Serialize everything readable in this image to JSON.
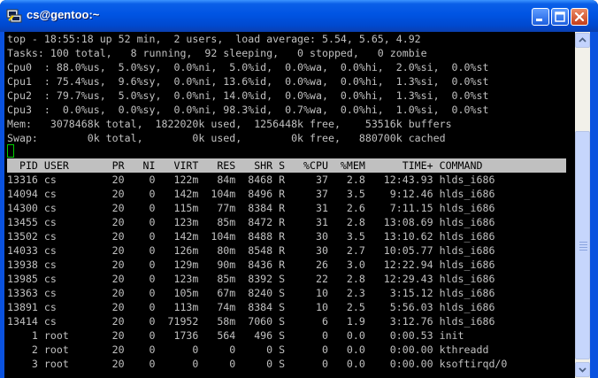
{
  "window": {
    "title": "cs@gentoo:~",
    "icon": "putty-terminal-icon"
  },
  "top": {
    "summary": [
      "top - 18:55:18 up 52 min,  2 users,  load average: 5.54, 5.65, 4.92",
      "Tasks: 100 total,   8 running,  92 sleeping,   0 stopped,   0 zombie",
      "Cpu0  : 88.0%us,  5.0%sy,  0.0%ni,  5.0%id,  0.0%wa,  0.0%hi,  2.0%si,  0.0%st",
      "Cpu1  : 75.4%us,  9.6%sy,  0.0%ni, 13.6%id,  0.0%wa,  0.0%hi,  1.3%si,  0.0%st",
      "Cpu2  : 79.7%us,  5.0%sy,  0.0%ni, 14.0%id,  0.0%wa,  0.0%hi,  1.3%si,  0.0%st",
      "Cpu3  :  0.0%us,  0.0%sy,  0.0%ni, 98.3%id,  0.7%wa,  0.0%hi,  1.0%si,  0.0%st",
      "Mem:   3078468k total,  1822020k used,  1256448k free,    53516k buffers",
      "Swap:        0k total,        0k used,        0k free,   880700k cached"
    ],
    "columns": [
      "PID",
      "USER",
      "PR",
      "NI",
      "VIRT",
      "RES",
      "SHR",
      "S",
      "%CPU",
      "%MEM",
      "TIME+",
      "COMMAND"
    ],
    "processes": [
      [
        "13316",
        "cs",
        "20",
        "0",
        "122m",
        "84m",
        "8468",
        "R",
        "37",
        "2.8",
        "12:43.93",
        "hlds_i686"
      ],
      [
        "14094",
        "cs",
        "20",
        "0",
        "142m",
        "104m",
        "8496",
        "R",
        "37",
        "3.5",
        "9:12.46",
        "hlds_i686"
      ],
      [
        "14300",
        "cs",
        "20",
        "0",
        "115m",
        "77m",
        "8384",
        "R",
        "31",
        "2.6",
        "7:11.15",
        "hlds_i686"
      ],
      [
        "13455",
        "cs",
        "20",
        "0",
        "123m",
        "85m",
        "8472",
        "R",
        "31",
        "2.8",
        "13:08.69",
        "hlds_i686"
      ],
      [
        "13502",
        "cs",
        "20",
        "0",
        "142m",
        "104m",
        "8488",
        "R",
        "30",
        "3.5",
        "13:10.62",
        "hlds_i686"
      ],
      [
        "14033",
        "cs",
        "20",
        "0",
        "126m",
        "80m",
        "8548",
        "R",
        "30",
        "2.7",
        "10:05.77",
        "hlds_i686"
      ],
      [
        "13938",
        "cs",
        "20",
        "0",
        "129m",
        "90m",
        "8436",
        "R",
        "26",
        "3.0",
        "12:22.94",
        "hlds_i686"
      ],
      [
        "13985",
        "cs",
        "20",
        "0",
        "123m",
        "85m",
        "8392",
        "S",
        "22",
        "2.8",
        "12:29.43",
        "hlds_i686"
      ],
      [
        "13363",
        "cs",
        "20",
        "0",
        "105m",
        "67m",
        "8240",
        "S",
        "10",
        "2.3",
        "3:15.12",
        "hlds_i686"
      ],
      [
        "13891",
        "cs",
        "20",
        "0",
        "113m",
        "74m",
        "8384",
        "S",
        "10",
        "2.5",
        "5:56.03",
        "hlds_i686"
      ],
      [
        "13414",
        "cs",
        "20",
        "0",
        "71952",
        "58m",
        "7060",
        "S",
        "6",
        "1.9",
        "3:12.76",
        "hlds_i686"
      ],
      [
        "1",
        "root",
        "20",
        "0",
        "1736",
        "564",
        "496",
        "S",
        "0",
        "0.0",
        "0:00.53",
        "init"
      ],
      [
        "2",
        "root",
        "20",
        "0",
        "0",
        "0",
        "0",
        "S",
        "0",
        "0.0",
        "0:00.00",
        "kthreadd"
      ],
      [
        "3",
        "root",
        "20",
        "0",
        "0",
        "0",
        "0",
        "S",
        "0",
        "0.0",
        "0:00.00",
        "ksoftirqd/0"
      ]
    ]
  },
  "colors": {
    "terminal_bg": "#000000",
    "terminal_fg": "#c0c0c0",
    "header_bg": "#c0c0c0",
    "cursor": "#00d000",
    "titlebar": "#0054e3"
  }
}
